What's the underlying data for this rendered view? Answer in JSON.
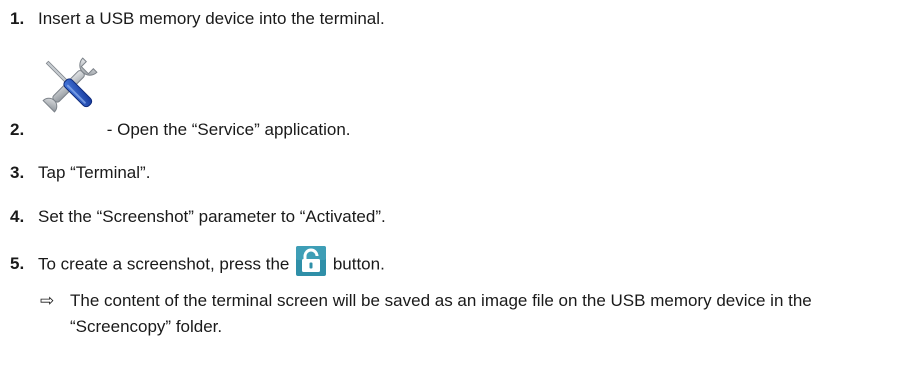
{
  "steps": [
    {
      "number": "1.",
      "text": "Insert a USB memory device into the terminal."
    },
    {
      "number": "2.",
      "text": " - Open the “Service” application.",
      "icon": "wrench-screwdriver-icon"
    },
    {
      "number": "3.",
      "text": "Tap “Terminal”."
    },
    {
      "number": "4.",
      "text": "Set the “Screenshot” parameter to “Activated”."
    },
    {
      "number": "5.",
      "text_before": "To create a screenshot, press the ",
      "text_after": " button.",
      "icon": "unlock-icon"
    }
  ],
  "result": {
    "arrow": "⇨",
    "text": "The content of the terminal screen will be saved as an image file on the USB memory device in the “Screencopy” folder."
  },
  "colors": {
    "text": "#1a1a1a",
    "unlock_button_bg": "#2f8fa8",
    "screwdriver_blue": "#1f4fb8",
    "wrench_gray": "#aeb3b8"
  }
}
